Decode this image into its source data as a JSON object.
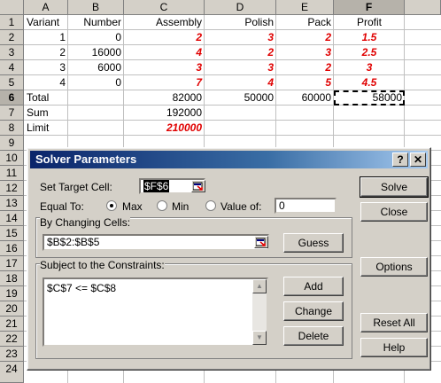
{
  "sheet": {
    "columns": [
      "A",
      "B",
      "C",
      "D",
      "E",
      "F"
    ],
    "rows": [
      "1",
      "2",
      "3",
      "4",
      "5",
      "6",
      "7",
      "8",
      "9",
      "10",
      "11",
      "12",
      "13",
      "14",
      "15",
      "16",
      "17",
      "18",
      "19",
      "20",
      "21",
      "22",
      "23",
      "24"
    ],
    "header_row": [
      "Variant",
      "Number",
      "Assembly",
      "Polish",
      "Pack",
      "Profit"
    ],
    "data": [
      [
        "1",
        "0",
        "2",
        "3",
        "2",
        "1.5"
      ],
      [
        "2",
        "16000",
        "4",
        "2",
        "3",
        "2.5"
      ],
      [
        "3",
        "6000",
        "3",
        "3",
        "2",
        "3"
      ],
      [
        "4",
        "0",
        "7",
        "4",
        "5",
        "4.5"
      ]
    ],
    "total_label": "Total",
    "total_values": [
      "82000",
      "50000",
      "60000",
      "58000"
    ],
    "sum_label": "Sum",
    "sum_value": "192000",
    "limit_label": "Limit",
    "limit_value": "210000",
    "highlight_color": "#e00000"
  },
  "dialog": {
    "title": "Solver Parameters",
    "help_btn": "?",
    "close_btn": "✕",
    "target_label": "Set Target Cell:",
    "target_value": "$F$6",
    "equal_to_label": "Equal To:",
    "opt_max": "Max",
    "opt_min": "Min",
    "opt_value": "Value of:",
    "value_of_field": "0",
    "changing_label": "By Changing Cells:",
    "changing_value": "$B$2:$B$5",
    "constraints_label": "Subject to the Constraints:",
    "constraints": [
      "$C$7 <= $C$8"
    ],
    "btn_solve": "Solve",
    "btn_close": "Close",
    "btn_guess": "Guess",
    "btn_options": "Options",
    "btn_add": "Add",
    "btn_change": "Change",
    "btn_delete": "Delete",
    "btn_reset": "Reset All",
    "btn_help": "Help"
  }
}
